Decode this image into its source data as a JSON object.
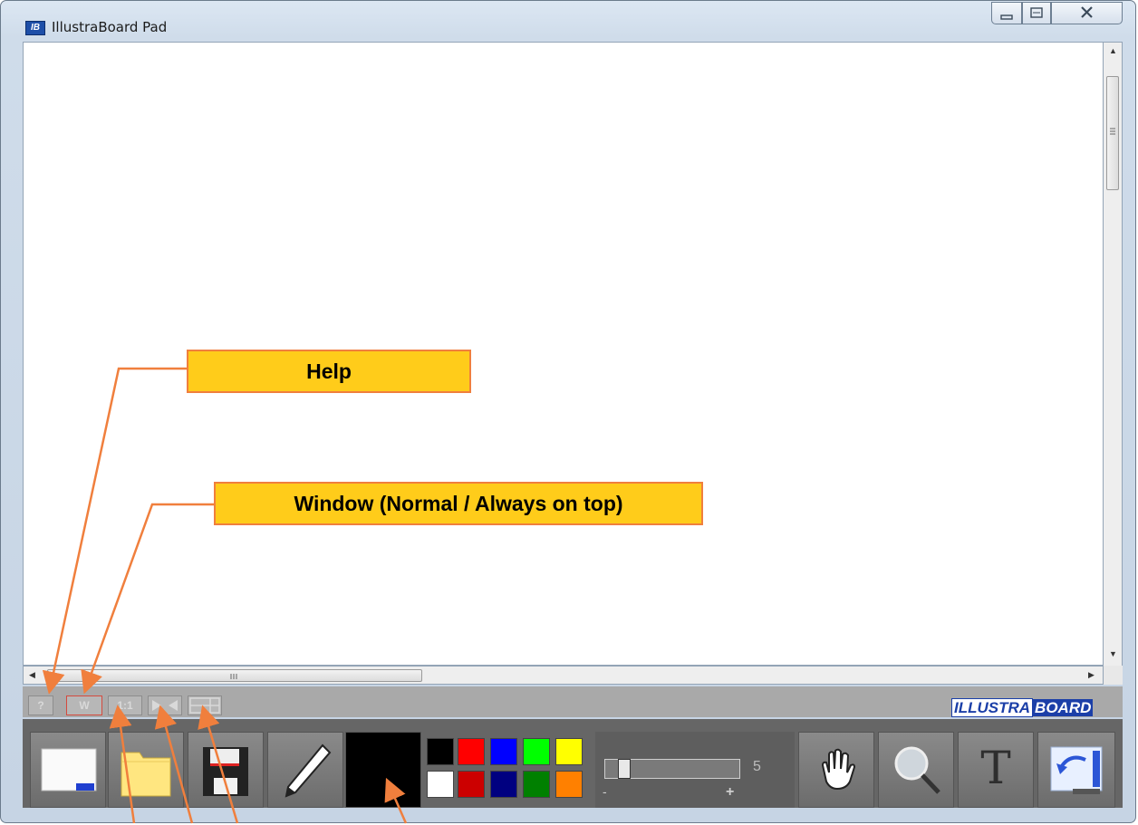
{
  "window": {
    "icon_text": "IB",
    "title": "IllustraBoard Pad"
  },
  "mini_toolbar": {
    "help_label": "?",
    "window_label": "W",
    "scale_label": "1:1",
    "logo_part1": "ILLUSTRA",
    "logo_part2": "BOARD"
  },
  "main_toolbar": {
    "tools": [
      "new",
      "open",
      "save",
      "pen",
      "current-color",
      "palette",
      "brush-size",
      "pan",
      "zoom",
      "text",
      "undo"
    ],
    "current_color": "#000000",
    "palette": {
      "top_row": [
        "#000000",
        "#ff0000",
        "#0000ff",
        "#00ff00",
        "#ffff00"
      ],
      "bottom_row": [
        "#ffffff",
        "#cc0000",
        "#000080",
        "#008000",
        "#ff8000"
      ]
    },
    "brush_size": {
      "value": "5",
      "minus_label": "-",
      "plus_label": "+"
    },
    "text_tool_label": "T"
  },
  "callouts": {
    "help": "Help",
    "window": "Window (Normal / Always on top)"
  },
  "colors": {
    "callout_fill": "#ffcc1a",
    "callout_border": "#f07f3d",
    "toolbar_bg": "#666666",
    "logo_blue": "#1b3fa8"
  }
}
